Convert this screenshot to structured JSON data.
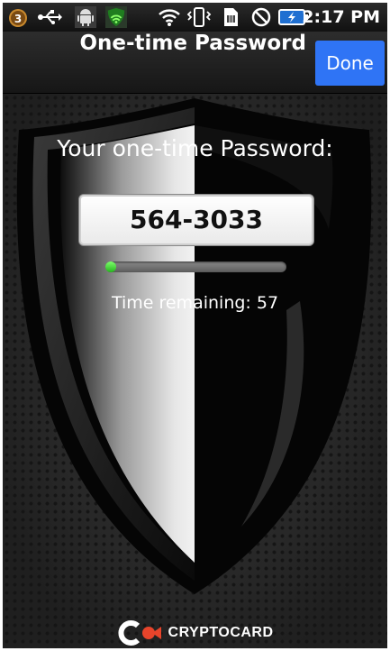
{
  "status_bar": {
    "notification_count": "3",
    "icons": [
      "notification-badge-icon",
      "usb-icon",
      "android-debug-icon",
      "signal-shield-icon",
      "wifi-icon",
      "vibrate-icon",
      "sim-icon",
      "no-signal-icon",
      "battery-charging-icon"
    ],
    "time": "2:17 PM"
  },
  "title_bar": {
    "title": "One-time Password",
    "done_label": "Done",
    "done_color": "#2f74f5"
  },
  "otp": {
    "heading": "Your one-time Password:",
    "code": "564-3033",
    "progress_fraction": 0.04,
    "time_remaining_label": "Time remaining: 57"
  },
  "brand": {
    "name": "CRYPTOCARD",
    "accent": "#e8442b"
  }
}
